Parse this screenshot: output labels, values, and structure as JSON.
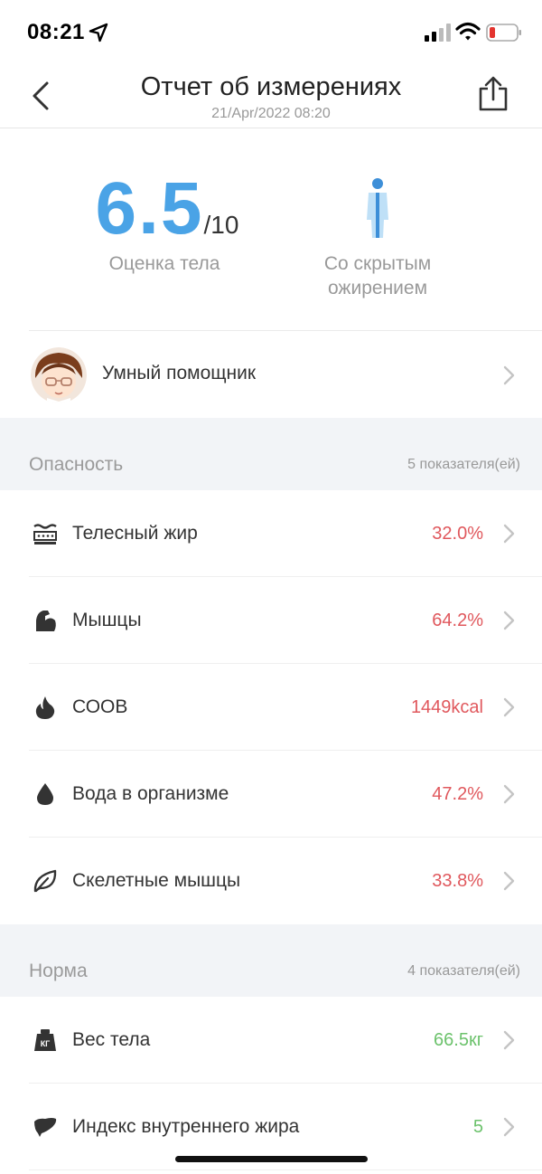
{
  "status_bar": {
    "time": "08:21"
  },
  "nav": {
    "title": "Отчет об измерениях",
    "subtitle": "21/Apr/2022 08:20"
  },
  "score": {
    "value": "6.5",
    "max": "/10",
    "label": "Оценка тела"
  },
  "body_type": {
    "label_line1": "Со скрытым",
    "label_line2": "ожирением"
  },
  "assistant": {
    "label": "Умный помощник"
  },
  "sections": [
    {
      "title": "Опасность",
      "count": "5 показателя(ей)",
      "status_color": "#e0585d",
      "items": [
        {
          "icon": "body-fat-icon",
          "label": "Телесный жир",
          "value": "32.0%"
        },
        {
          "icon": "muscle-icon",
          "label": "Мышцы",
          "value": "64.2%"
        },
        {
          "icon": "flame-icon",
          "label": "СООВ",
          "value": "1449kcal"
        },
        {
          "icon": "water-drop-icon",
          "label": "Вода в организме",
          "value": "47.2%"
        },
        {
          "icon": "leaf-icon",
          "label": "Скелетные мышцы",
          "value": "33.8%"
        }
      ]
    },
    {
      "title": "Норма",
      "count": "4 показателя(ей)",
      "status_color": "#6cc26c",
      "items": [
        {
          "icon": "weight-icon",
          "label": "Вес тела",
          "value": "66.5кг",
          "icon_text": "КГ"
        },
        {
          "icon": "liver-icon",
          "label": "Индекс внутреннего жира",
          "value": "5"
        }
      ]
    }
  ],
  "colors": {
    "accent": "#4aa3e6",
    "danger": "#e0585d",
    "normal": "#6cc26c",
    "section_bg": "#f2f4f7"
  }
}
